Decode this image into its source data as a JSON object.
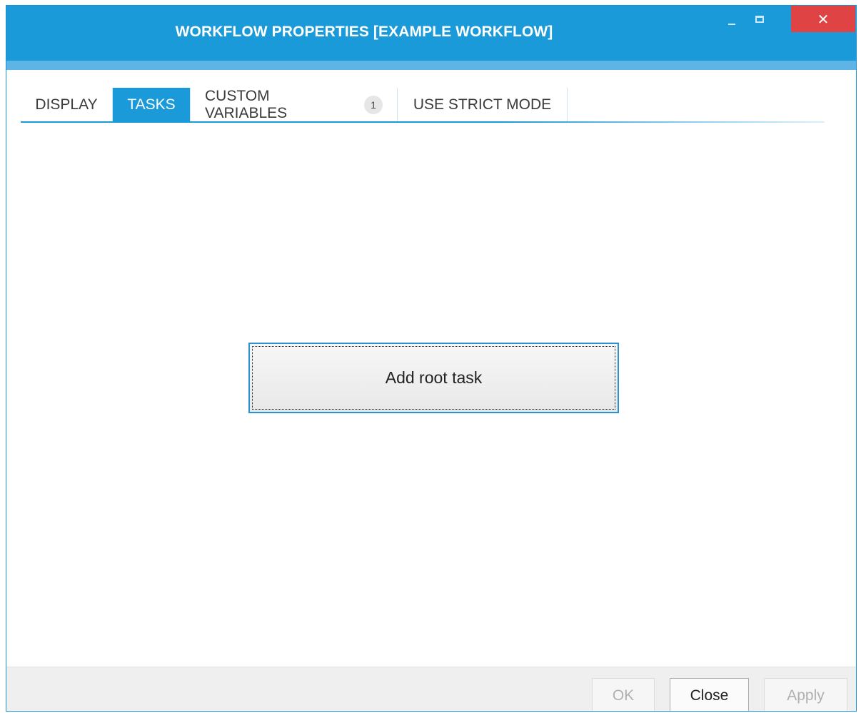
{
  "window": {
    "title": "WORKFLOW PROPERTIES [EXAMPLE WORKFLOW]",
    "controls": {
      "minimize_icon": "minimize-icon",
      "maximize_icon": "maximize-icon",
      "close_glyph": "✕"
    }
  },
  "tabs": [
    {
      "label": "DISPLAY",
      "active": false
    },
    {
      "label": "TASKS",
      "active": true
    },
    {
      "label": "CUSTOM VARIABLES",
      "badge": "1",
      "active": false
    },
    {
      "label": "USE STRICT MODE",
      "active": false
    }
  ],
  "content": {
    "add_root_task_label": "Add root task"
  },
  "footer": {
    "ok_label": "OK",
    "close_label": "Close",
    "apply_label": "Apply",
    "ok_enabled": false,
    "close_enabled": true,
    "apply_enabled": false
  },
  "colors": {
    "accent": "#1b9ad9",
    "accent_light": "#5eb4e6",
    "close_button": "#e04343",
    "footer_bg": "#efefef"
  }
}
